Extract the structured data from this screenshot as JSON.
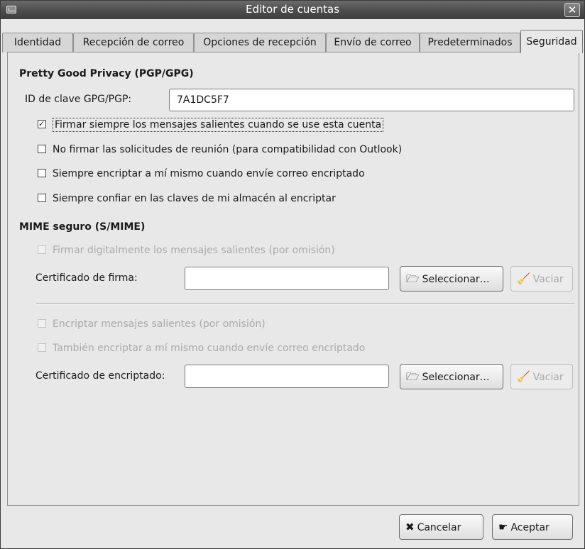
{
  "window": {
    "title": "Editor de cuentas"
  },
  "tabs": [
    {
      "label": "Identidad"
    },
    {
      "label": "Recepción de correo"
    },
    {
      "label": "Opciones de recepción"
    },
    {
      "label": "Envío de correo"
    },
    {
      "label": "Predeterminados"
    },
    {
      "label": "Seguridad",
      "active": true
    }
  ],
  "pgp": {
    "title": "Pretty Good Privacy (PGP/GPG)",
    "key_label": "ID de clave GPG/PGP:",
    "key_value": "7A1DC5F7",
    "options": [
      {
        "label": "Firmar siempre los mensajes salientes cuando se use esta cuenta",
        "checked": true
      },
      {
        "label": "No firmar las solicitudes de reunión (para compatibilidad con Outlook)",
        "checked": false
      },
      {
        "label": "Siempre encriptar a mí mismo cuando envíe correo encriptado",
        "checked": false
      },
      {
        "label": "Siempre confiar en las claves de mi almacén al encriptar",
        "checked": false
      }
    ]
  },
  "smime": {
    "title": "MIME seguro (S/MIME)",
    "sign_default": "Firmar digitalmente los mensajes salientes (por omisión)",
    "sign_cert_label": "Certificado de firma:",
    "sign_cert_value": "",
    "encrypt_default": "Encriptar mensajes salientes (por omisión)",
    "encrypt_self": "También encriptar a mí mismo cuando envíe correo encriptado",
    "encrypt_cert_label": "Certificado de encriptado:",
    "encrypt_cert_value": "",
    "select_label": "Seleccionar…",
    "clear_label": "Vaciar"
  },
  "footer": {
    "cancel_label": "Cancelar",
    "accept_label": "Aceptar"
  }
}
